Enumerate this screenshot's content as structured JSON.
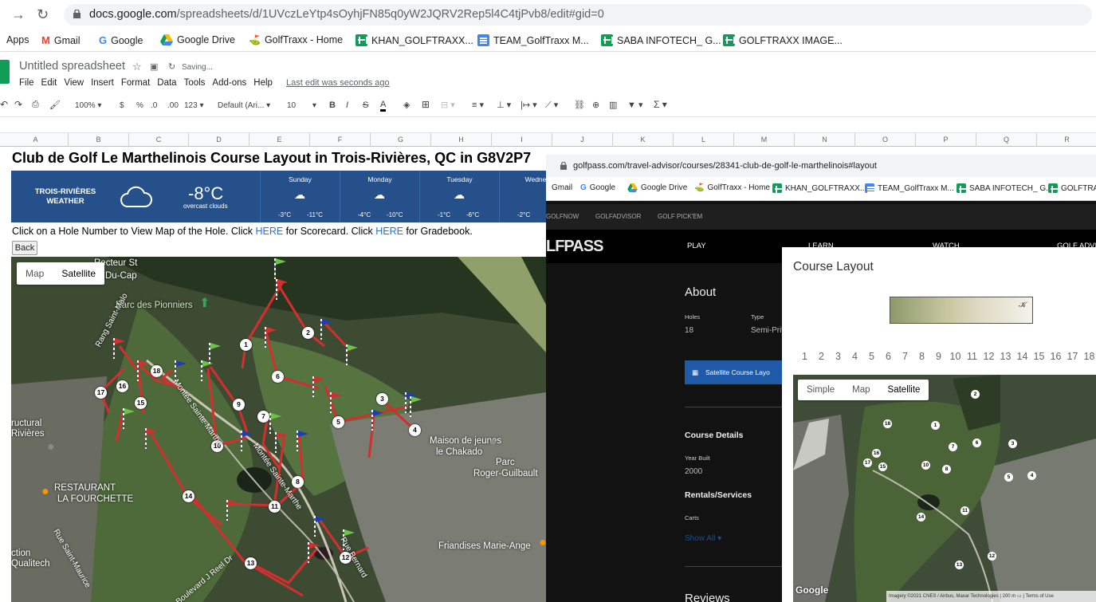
{
  "browser": {
    "url_host": "docs.google.com",
    "url_path": "/spreadsheets/d/1UVczLeYtp4sOyhjFN85q0yW2JQRV2Rep5l4C4tjPvb8/edit#gid=0",
    "bookmarks": [
      {
        "label": "Apps",
        "icon": "apps-icon"
      },
      {
        "label": "Gmail",
        "icon": "gmail-icon"
      },
      {
        "label": "Google",
        "icon": "google-icon"
      },
      {
        "label": "Google Drive",
        "icon": "drive-icon"
      },
      {
        "label": "GolfTraxx - Home",
        "icon": "golf-icon"
      },
      {
        "label": "KHAN_GOLFTRAXX...",
        "icon": "sheets-icon"
      },
      {
        "label": "TEAM_GolfTraxx M...",
        "icon": "docs-icon"
      },
      {
        "label": "SABA INFOTECH_ G...",
        "icon": "sheets-icon"
      },
      {
        "label": "GOLFTRAXX IMAGE...",
        "icon": "sheets-icon"
      }
    ]
  },
  "sheets": {
    "title": "Untitled spreadsheet",
    "saving": "Saving...",
    "menu": [
      "File",
      "Edit",
      "View",
      "Insert",
      "Format",
      "Data",
      "Tools",
      "Add-ons",
      "Help"
    ],
    "last_edit": "Last edit was seconds ago",
    "toolbar": {
      "zoom": "100%",
      "currency": "$",
      "percent": "%",
      "dec_dec": ".0",
      "dec_inc": ".00",
      "num_format": "123",
      "font": "Default (Ari...",
      "font_size": "10",
      "bold": "B",
      "italic": "I",
      "strike": "S",
      "text_color": "A",
      "sum": "Σ"
    },
    "columns": [
      "A",
      "B",
      "C",
      "D",
      "E",
      "F",
      "G",
      "H",
      "I",
      "J",
      "K",
      "L",
      "M",
      "N",
      "O",
      "P",
      "Q",
      "R"
    ]
  },
  "course_page": {
    "title": "Club de Golf Le Marthelinois Course Layout in Trois-Rivières, QC in G8V2P7",
    "weather": {
      "city": "TROIS-RIVIÈRES",
      "label": "WEATHER",
      "temp": "-8°C",
      "desc": "overcast clouds",
      "days": [
        {
          "name": "Sunday",
          "hi": "-3°C",
          "lo": "-11°C"
        },
        {
          "name": "Monday",
          "hi": "-4°C",
          "lo": "-10°C"
        },
        {
          "name": "Tuesday",
          "hi": "-1°C",
          "lo": "-6°C"
        },
        {
          "name": "Wednesd",
          "hi": "-2°C",
          "lo": ""
        }
      ]
    },
    "instr_a": "Click on a Hole Number to View Map of the Hole. Click ",
    "here1": "HERE",
    "instr_b": " for Scorecard. Click ",
    "here2": "HERE",
    "instr_c": " for Gradebook.",
    "back": "Back",
    "map": {
      "toggle": [
        "Map",
        "Satellite"
      ],
      "places": [
        "Parc des Pionniers",
        "Recteur St",
        "Du-Cap",
        "Rang Saint-Malo",
        "Montée Sainte-Marthe",
        "Maison de jeunes",
        "le Chakado",
        "Parc",
        "Roger-Guilbault",
        "RESTAURANT",
        "LA FOURCHETTE",
        "Rue Saint-Maurice",
        "ructural",
        "Rivières",
        "Friandises Marie-Ange",
        "ction",
        "Qualitech",
        "Boulevard J Reel Dr",
        "Rue Bernard"
      ],
      "holes": [
        "1",
        "2",
        "3",
        "4",
        "5",
        "6",
        "7",
        "8",
        "9",
        "10",
        "11",
        "12",
        "13",
        "14",
        "15",
        "16",
        "17",
        "18"
      ]
    }
  },
  "golfpass": {
    "url": "golfpass.com/travel-advisor/courses/28341-club-de-golf-le-marthelinois#layout",
    "bookmarks": [
      "Gmail",
      "Google",
      "Google Drive",
      "GolfTraxx - Home",
      "KHAN_GOLFTRAXX...",
      "TEAM_GolfTraxx M...",
      "SABA INFOTECH_ G...",
      "GOLFTRAX"
    ],
    "subnav": [
      "GOLFNOW",
      "GOLFADVISOR",
      "GOLF PICK'EM"
    ],
    "logo": "LFPASS",
    "nav": [
      "PLAY",
      "LEARN",
      "WATCH",
      "GOLF ADVI"
    ],
    "about": {
      "heading": "About",
      "holes_label": "Holes",
      "holes_value": "18",
      "type_label": "Type",
      "type_value": "Semi-Priv"
    },
    "sat_button": "Satellite Course Layo",
    "details": {
      "heading": "Course Details",
      "year_label": "Year Built",
      "year_value": "2000"
    },
    "rentals": {
      "heading": "Rentals/Services",
      "item": "Carts",
      "show_all": "Show All"
    },
    "reviews": "Reviews",
    "modal": {
      "title": "Course Layout",
      "holes": [
        "1",
        "2",
        "3",
        "4",
        "5",
        "6",
        "7",
        "8",
        "9",
        "10",
        "11",
        "12",
        "13",
        "14",
        "15",
        "16",
        "17",
        "18"
      ],
      "toggle": [
        "Simple",
        "Map",
        "Satellite"
      ],
      "google": "Google",
      "attribution": "Imagery ©2021 CNES / Airbus, Maxar Technologies",
      "scale": "200 m",
      "terms": "Terms of Use"
    }
  },
  "colors": {
    "weather_bg": "#25508a",
    "link": "#1a73e8",
    "route": "#d32f2f"
  }
}
